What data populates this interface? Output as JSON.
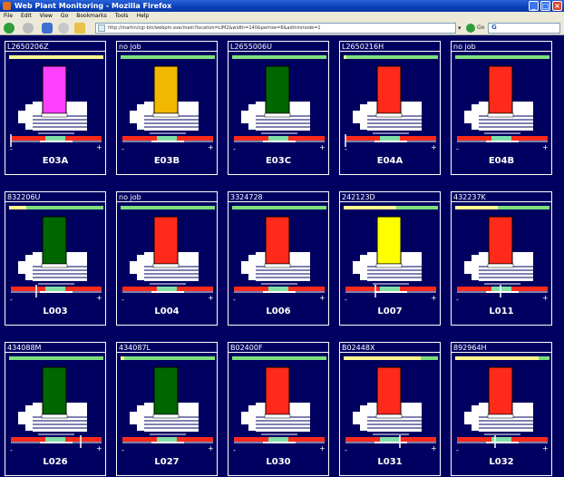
{
  "window": {
    "title": "Web Plant Monitoring - Mozilla Firefox"
  },
  "menu": [
    "File",
    "Edit",
    "View",
    "Go",
    "Bookmarks",
    "Tools",
    "Help"
  ],
  "nav": {
    "url": "http://martin/cgi-bin/webpm.exe/main?location=LIM2&width=140&perrow=6&adminmode=1",
    "go_label": "Go",
    "search_value": "G"
  },
  "colors": {
    "magenta": "#ff40ff",
    "orange": "#f2b800",
    "green": "#006600",
    "red": "#ff2a1a",
    "yellow": "#ffff00",
    "background": "#000060"
  },
  "machines": [
    {
      "job": "L2650206Z",
      "name": "E03A",
      "color": "#ff40ff",
      "progress": 1.0,
      "indicator": 0.0
    },
    {
      "job": "no job",
      "name": "E03B",
      "color": "#f2b800",
      "progress": 0.0,
      "indicator": null
    },
    {
      "job": "L2655006U",
      "name": "E03C",
      "color": "#006600",
      "progress": 0.0,
      "indicator": null
    },
    {
      "job": "L2650216H",
      "name": "E04A",
      "color": "#ff2a1a",
      "progress": 0.03,
      "indicator": 0.0
    },
    {
      "job": "no job",
      "name": "E04B",
      "color": "#ff2a1a",
      "progress": 0.0,
      "indicator": null
    },
    {
      "job": "832206U",
      "name": "L003",
      "color": "#006600",
      "progress": 0.18,
      "indicator": 0.28
    },
    {
      "job": "no job",
      "name": "L004",
      "color": "#ff2a1a",
      "progress": 0.0,
      "indicator": null
    },
    {
      "job": "3324728",
      "name": "L006",
      "color": "#ff2a1a",
      "progress": 0.0,
      "indicator": null
    },
    {
      "job": "242123D",
      "name": "L007",
      "color": "#ffff00",
      "progress": 0.56,
      "indicator": 0.33
    },
    {
      "job": "432237K",
      "name": "L011",
      "color": "#ff2a1a",
      "progress": 0.45,
      "indicator": 0.48
    },
    {
      "job": "434088M",
      "name": "L026",
      "color": "#006600",
      "progress": 0.0,
      "indicator": 0.77
    },
    {
      "job": "434087L",
      "name": "L027",
      "color": "#006600",
      "progress": 0.04,
      "indicator": null
    },
    {
      "job": "B02400F",
      "name": "L030",
      "color": "#ff2a1a",
      "progress": 0.0,
      "indicator": null
    },
    {
      "job": "B02448X",
      "name": "L031",
      "color": "#ff2a1a",
      "progress": 0.82,
      "indicator": 0.6
    },
    {
      "job": "892964H",
      "name": "L032",
      "color": "#ff2a1a",
      "progress": 0.88,
      "indicator": 0.42
    }
  ],
  "gauge": {
    "minus": "-",
    "plus": "+"
  }
}
